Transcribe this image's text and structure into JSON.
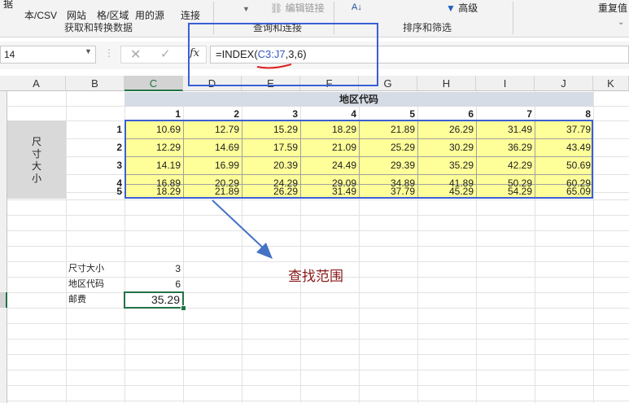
{
  "ribbon": {
    "btn_text_csv": [
      "据",
      "本/CSV"
    ],
    "btn_web": [
      "",
      "网站"
    ],
    "btn_table": [
      "",
      "格/区域"
    ],
    "btn_recent": [
      "",
      "用的源"
    ],
    "btn_connect": [
      "",
      "连接"
    ],
    "btn_edit_links": "编辑链接",
    "btn_advanced": "高级",
    "btn_dedupe": "重复值",
    "group_get_transform": "获取和转换数据",
    "group_queries": "查询和连接",
    "group_sort_filter": "排序和筛选"
  },
  "formula_bar": {
    "name_box": "14",
    "fx_label": "fx",
    "formula": "=INDEX(C3:J7,3,6)",
    "formula_prefix": "=INDEX(",
    "formula_range": "C3:J7",
    "formula_suffix": ",3,6)"
  },
  "columns": [
    "A",
    "B",
    "C",
    "D",
    "E",
    "F",
    "G",
    "H",
    "I",
    "J",
    "K"
  ],
  "table": {
    "merged_header": "地区代码",
    "col_numbers": [
      "1",
      "2",
      "3",
      "4",
      "5",
      "6",
      "7",
      "8"
    ],
    "row_label": [
      "尺",
      "寸",
      "大",
      "小"
    ],
    "row_numbers": [
      "1",
      "2",
      "3",
      "4",
      "5"
    ],
    "rows": [
      [
        "10.69",
        "12.79",
        "15.29",
        "18.29",
        "21.89",
        "26.29",
        "31.49",
        "37.79"
      ],
      [
        "12.29",
        "14.69",
        "17.59",
        "21.09",
        "25.29",
        "30.29",
        "36.29",
        "43.49"
      ],
      [
        "14.19",
        "16.99",
        "20.39",
        "24.49",
        "29.39",
        "35.29",
        "42.29",
        "50.69"
      ],
      [
        "16.89",
        "20.29",
        "24.29",
        "29.09",
        "34.89",
        "41.89",
        "50.29",
        "60.29"
      ],
      [
        "18.29",
        "21.89",
        "26.29",
        "31.49",
        "37.79",
        "45.29",
        "54.29",
        "65.09"
      ]
    ]
  },
  "lookup": {
    "size_label": "尺寸大小",
    "size_value": "3",
    "region_label": "地区代码",
    "region_value": "6",
    "fee_label": "邮费",
    "fee_value": "35.29"
  },
  "annotation": {
    "text": "查找范围",
    "color": "#8b1a1a",
    "box_color": "#3a5fd6"
  }
}
